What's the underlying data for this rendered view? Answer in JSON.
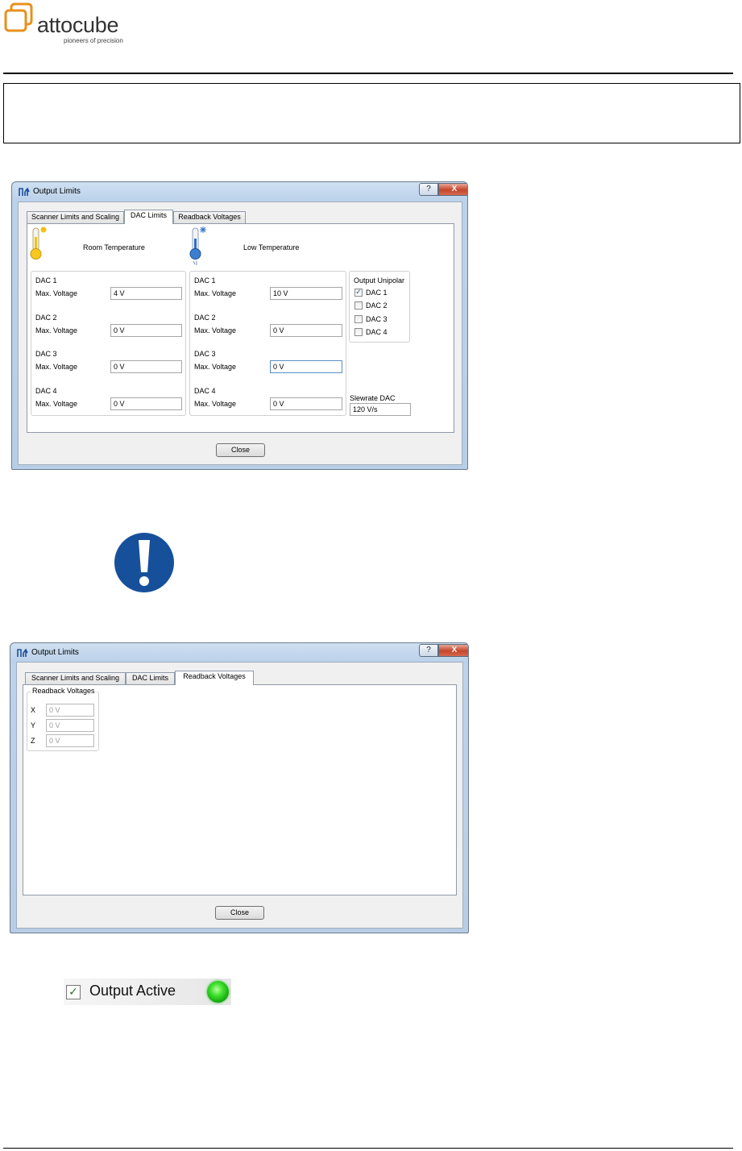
{
  "brand": {
    "name": "attocube",
    "tagline": "pioneers of precision",
    "color": "#e8901c"
  },
  "dialog_dac": {
    "title": "Output Limits",
    "help_label": "?",
    "close_caption": "X",
    "tabs": [
      {
        "label": "Scanner Limits and Scaling",
        "active": false
      },
      {
        "label": "DAC Limits",
        "active": true
      },
      {
        "label": "Readback Voltages",
        "active": false
      }
    ],
    "room_temperature_label": "Room Temperature",
    "low_temperature_label": "Low Temperature",
    "room_dacs": [
      {
        "name": "DAC 1",
        "field_label": "Max. Voltage",
        "value": "4 V"
      },
      {
        "name": "DAC 2",
        "field_label": "Max. Voltage",
        "value": "0 V"
      },
      {
        "name": "DAC 3",
        "field_label": "Max. Voltage",
        "value": "0 V"
      },
      {
        "name": "DAC 4",
        "field_label": "Max. Voltage",
        "value": "0 V"
      }
    ],
    "low_dacs": [
      {
        "name": "DAC 1",
        "field_label": "Max. Voltage",
        "value": "10 V"
      },
      {
        "name": "DAC 2",
        "field_label": "Max. Voltage",
        "value": "0 V"
      },
      {
        "name": "DAC 3",
        "field_label": "Max. Voltage",
        "value": "0 V"
      },
      {
        "name": "DAC 4",
        "field_label": "Max. Voltage",
        "value": "0 V"
      }
    ],
    "output_unipolar": {
      "title": "Output Unipolar",
      "items": [
        {
          "label": "DAC 1",
          "checked": true
        },
        {
          "label": "DAC 2",
          "checked": false
        },
        {
          "label": "DAC 3",
          "checked": false
        },
        {
          "label": "DAC 4",
          "checked": false
        }
      ]
    },
    "slewrate_label": "Slewrate DAC",
    "slewrate_value": "120 V/s",
    "close_button": "Close"
  },
  "dialog_readback": {
    "title": "Output Limits",
    "help_label": "?",
    "close_caption": "X",
    "tabs": [
      {
        "label": "Scanner Limits and Scaling",
        "active": false
      },
      {
        "label": "DAC Limits",
        "active": false
      },
      {
        "label": "Readback Voltages",
        "active": true
      }
    ],
    "group_title": "Readback Voltages",
    "axes": [
      {
        "label": "X",
        "value": "0 V"
      },
      {
        "label": "Y",
        "value": "0 V"
      },
      {
        "label": "Z",
        "value": "0 V"
      }
    ],
    "close_button": "Close"
  },
  "output_active": {
    "label": "Output Active",
    "checked": true,
    "led_color": "#2ad41e"
  }
}
